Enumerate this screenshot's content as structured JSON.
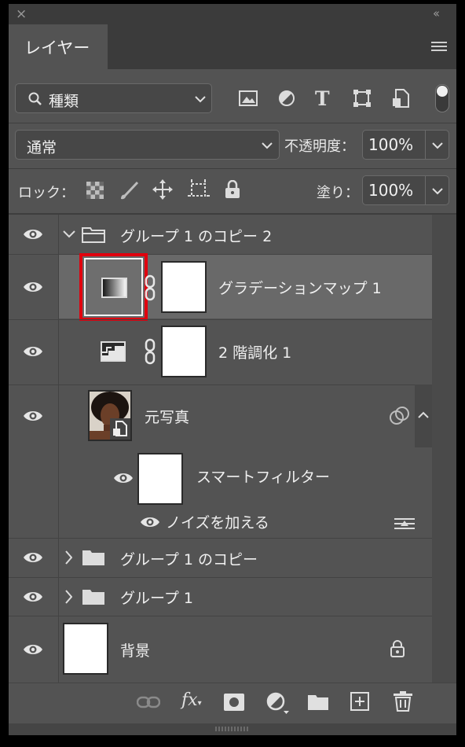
{
  "panel": {
    "tab_label": "レイヤー",
    "close_glyph": "×",
    "collapse_glyph": "‹‹"
  },
  "filter": {
    "label": "種類"
  },
  "blend": {
    "mode": "通常",
    "opacity_label": "不透明度：",
    "opacity_value": "100%"
  },
  "lock": {
    "label": "ロック：",
    "fill_label": "塗り：",
    "fill_value": "100%"
  },
  "layers": [
    {
      "name": "グループ 1 のコピー 2",
      "type": "group",
      "expanded": true
    },
    {
      "name": "グラデーションマップ 1",
      "type": "adjustment-gradient-map",
      "selected": true
    },
    {
      "name": "2 階調化 1",
      "type": "adjustment-threshold"
    },
    {
      "name": "元写真",
      "type": "smart-object"
    },
    {
      "name": "スマートフィルター",
      "type": "smart-filter"
    },
    {
      "name": "ノイズを加える",
      "type": "filter"
    },
    {
      "name": "グループ 1 のコピー",
      "type": "group",
      "expanded": false
    },
    {
      "name": "グループ 1",
      "type": "group",
      "expanded": false
    },
    {
      "name": "背景",
      "type": "background",
      "locked": true
    }
  ],
  "colors": {
    "panel": "#535353",
    "header": "#3b3b3b",
    "selected_row": "#696969",
    "highlight": "#e0000e"
  }
}
